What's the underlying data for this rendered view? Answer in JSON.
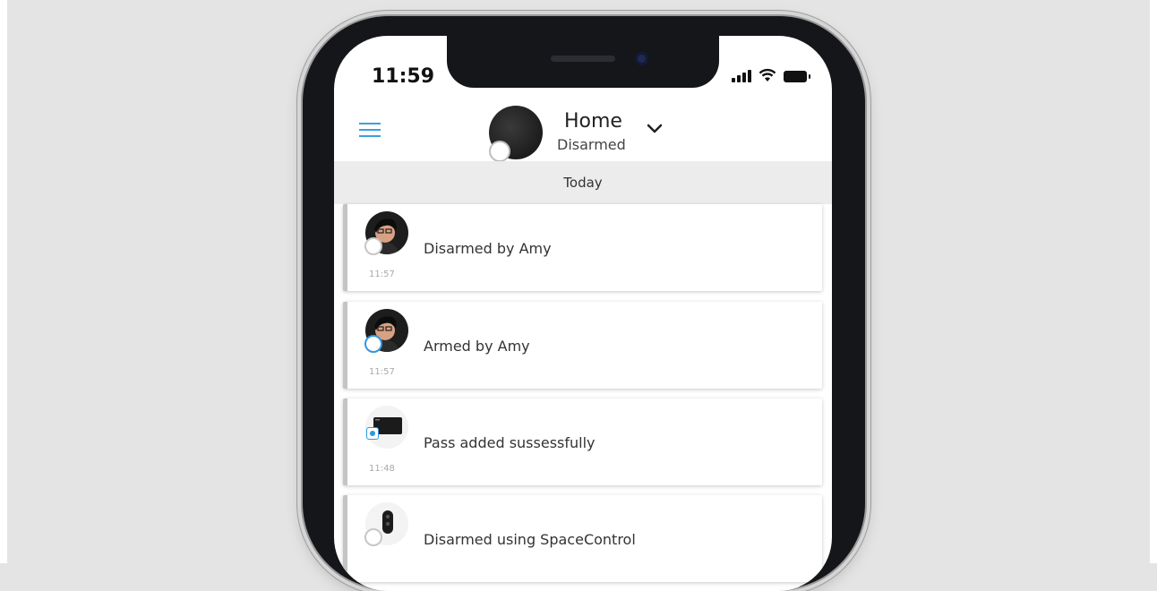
{
  "status_bar": {
    "time": "11:59"
  },
  "header": {
    "menu_icon": "hamburger-menu-icon",
    "hub_name": "Home",
    "hub_status": "Disarmed",
    "dropdown_icon": "chevron-down-icon"
  },
  "feed": {
    "date_label": "Today",
    "events": [
      {
        "text": "Disarmed by Amy",
        "time": "11:57",
        "icon": "user-avatar-icon"
      },
      {
        "text": "Armed by Amy",
        "time": "11:57",
        "icon": "user-avatar-icon"
      },
      {
        "text": "Pass added sussessfully",
        "time": "11:48",
        "icon": "pass-card-icon"
      },
      {
        "text": "Disarmed using SpaceControl",
        "time": "",
        "icon": "spacecontrol-fob-icon"
      }
    ]
  },
  "colors": {
    "accent": "#3aa1e0",
    "background": "#e4e4e4",
    "card_border": "#c4c4c4"
  }
}
